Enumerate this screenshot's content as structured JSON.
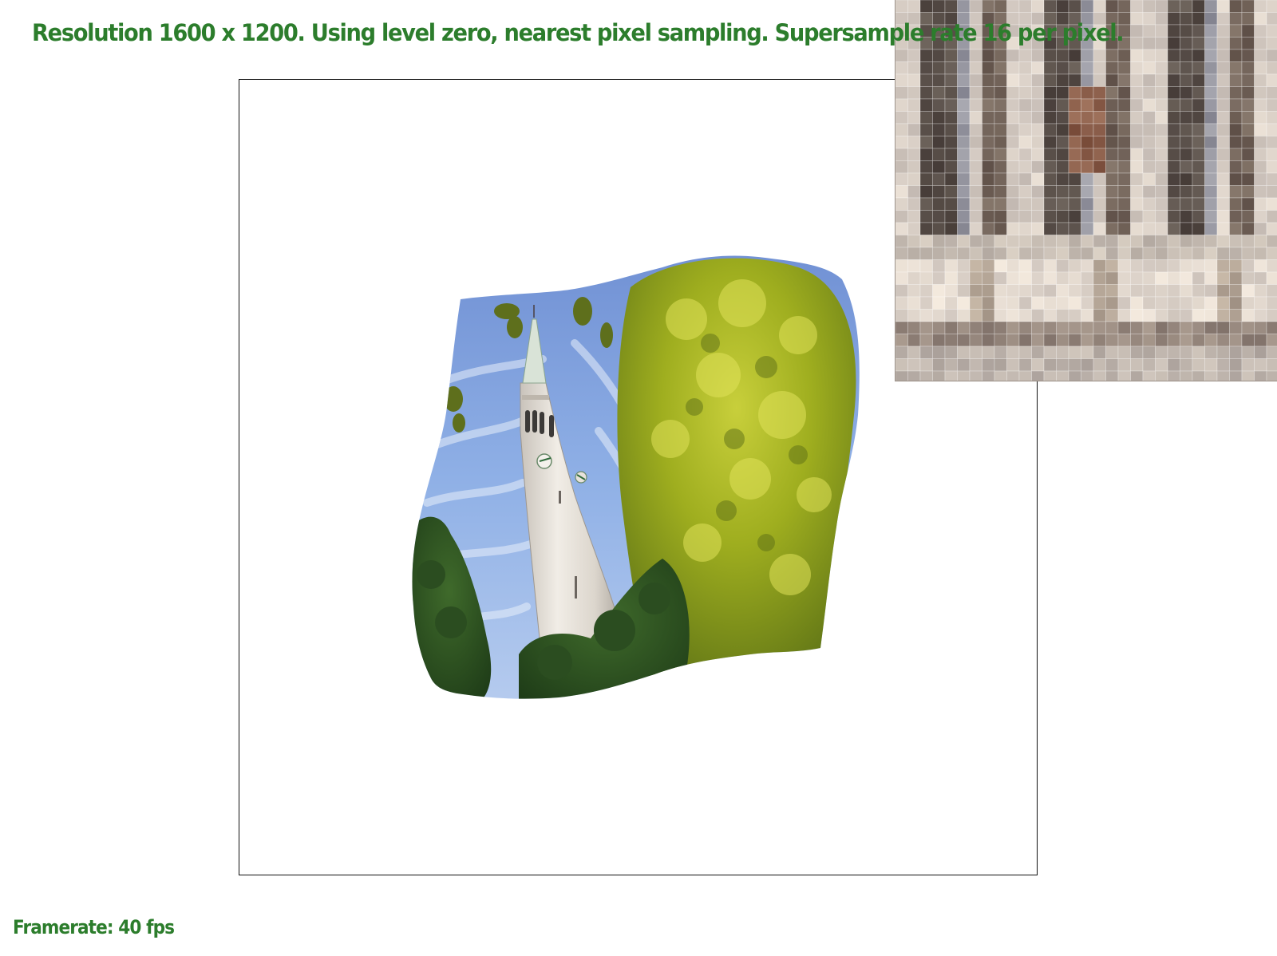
{
  "app": {
    "status_line": "Resolution 1600 x 1200. Using level zero, nearest pixel sampling. Supersample rate 16 per pixel.",
    "framerate": "Framerate: 40 fps"
  },
  "colors": {
    "status_text": "#2c7d2c",
    "background": "#ffffff",
    "viewport_border": "#111111"
  },
  "viewport": {
    "content": "warped texture render of a clock tower with trees and sky"
  },
  "zoom_inset": {
    "content": "pixel-magnified view showing sampled texel grid"
  }
}
